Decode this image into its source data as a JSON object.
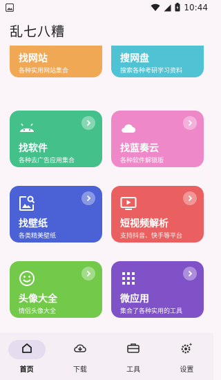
{
  "status_bar": {
    "time": "10:44"
  },
  "app_bar": {
    "title": "乱七八糟"
  },
  "cards": [
    {
      "id": "find-websites",
      "title": "找网站",
      "subtitle": "各种实用网站集合",
      "color": "#f0a855",
      "icon": "ie-icon"
    },
    {
      "id": "search-pan",
      "title": "搜网盘",
      "subtitle": "搜索各种考研学习资料",
      "color": "#4fc3d4",
      "icon": "drive-icon"
    },
    {
      "id": "find-software",
      "title": "找软件",
      "subtitle": "各种去广告应用集合",
      "color": "#44c08a",
      "icon": "android-icon"
    },
    {
      "id": "lanzou-cloud",
      "title": "找蓝奏云",
      "subtitle": "各种软件解锁版",
      "color": "#ee88c8",
      "icon": "cloud-icon"
    },
    {
      "id": "find-wallpaper",
      "title": "找壁纸",
      "subtitle": "各类精美壁纸",
      "color": "#4a62d6",
      "icon": "image-search-icon"
    },
    {
      "id": "video-parse",
      "title": "短视频解析",
      "subtitle": "支持抖音、快手等平台",
      "color": "#ea5f5f",
      "icon": "tv-play-icon"
    },
    {
      "id": "avatar",
      "title": "头像大全",
      "subtitle": "情侣头像大全",
      "color": "#72c94a",
      "icon": "smile-icon"
    },
    {
      "id": "mini-apps",
      "title": "微应用",
      "subtitle": "集合了各种实用的工具",
      "color": "#8052c8",
      "icon": "apps-grid-icon"
    }
  ],
  "bottom_nav": [
    {
      "label": "首页",
      "icon": "home-icon",
      "active": true
    },
    {
      "label": "下载",
      "icon": "cloud-download-icon",
      "active": false
    },
    {
      "label": "工具",
      "icon": "toolbox-icon",
      "active": false
    },
    {
      "label": "设置",
      "icon": "settings-icon",
      "active": false
    }
  ]
}
